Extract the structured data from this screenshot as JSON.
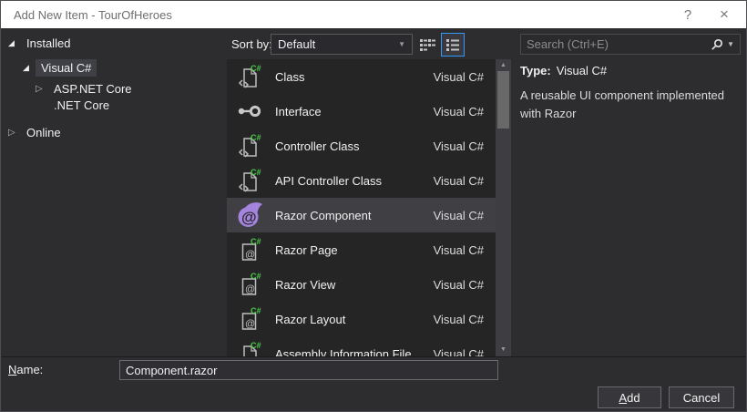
{
  "window": {
    "title": "Add New Item - TourOfHeroes",
    "help_label": "?",
    "close_label": "×"
  },
  "icons": {
    "tree_expanded": "◢",
    "tree_collapsed": "▷",
    "caret_down": "▼",
    "scroll_up": "▲",
    "scroll_down": "▼"
  },
  "tree": {
    "items": [
      {
        "label": "Installed",
        "state": "expanded",
        "level": 0,
        "selected": false
      },
      {
        "label": "Visual C#",
        "state": "expanded",
        "level": 1,
        "selected": true
      },
      {
        "label": "ASP.NET Core",
        "state": "collapsed",
        "level": 2,
        "selected": false
      },
      {
        "label": ".NET Core",
        "state": "none",
        "level": 2,
        "selected": false
      },
      {
        "label": "Online",
        "state": "collapsed",
        "level": 0,
        "selected": false
      }
    ]
  },
  "toolbar": {
    "sort_label": "Sort by:",
    "sort_value": "Default"
  },
  "search": {
    "placeholder": "Search (Ctrl+E)"
  },
  "list": {
    "items": [
      {
        "name": "Class",
        "type": "Visual C#",
        "icon": "csharp-class-file",
        "selected": false
      },
      {
        "name": "Interface",
        "type": "Visual C#",
        "icon": "interface",
        "selected": false
      },
      {
        "name": "Controller Class",
        "type": "Visual C#",
        "icon": "csharp-class-file",
        "selected": false
      },
      {
        "name": "API Controller Class",
        "type": "Visual C#",
        "icon": "csharp-class-file",
        "selected": false
      },
      {
        "name": "Razor Component",
        "type": "Visual C#",
        "icon": "blazor-flame",
        "selected": true
      },
      {
        "name": "Razor Page",
        "type": "Visual C#",
        "icon": "razor-file",
        "selected": false
      },
      {
        "name": "Razor View",
        "type": "Visual C#",
        "icon": "razor-file",
        "selected": false
      },
      {
        "name": "Razor Layout",
        "type": "Visual C#",
        "icon": "razor-file",
        "selected": false
      },
      {
        "name": "Assembly Information File",
        "type": "Visual C#",
        "icon": "csharp-file",
        "selected": false,
        "clipped": true
      }
    ]
  },
  "details": {
    "type_label": "Type:",
    "type_value": "Visual C#",
    "description": "A reusable UI component implemented with Razor"
  },
  "name_field": {
    "label_mnemonic": "N",
    "label_rest": "ame:",
    "value": "Component.razor"
  },
  "footer": {
    "add_mnemonic": "A",
    "add_rest": "dd",
    "cancel_label": "Cancel"
  },
  "colors": {
    "dialog_bg": "#2D2D30",
    "list_bg": "#252526",
    "selection_bg": "#3F3F44",
    "tree_selection_bg": "#3F3F46",
    "accent_blue": "#3399FF",
    "csharp_green": "#4EC94E",
    "blazor_purple": "#A584DD",
    "titlebar_bg": "#FFFFFF",
    "titlebar_text": "#6F6F6F"
  }
}
